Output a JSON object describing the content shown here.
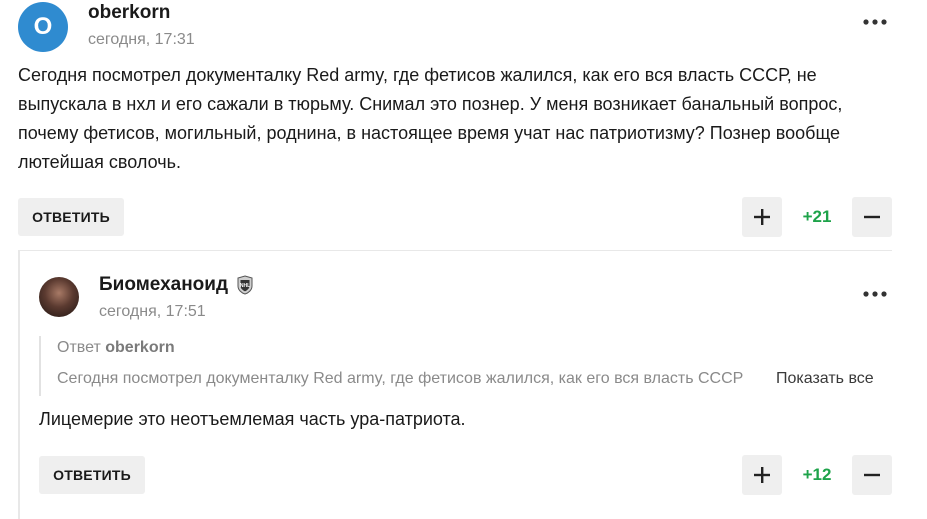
{
  "comment": {
    "avatar_letter": "O",
    "author": "oberkorn",
    "time": "сегодня, 17:31",
    "text_lines": [
      "Сегодня посмотрел документалку Red army, где фетисов жалился, как его вся власть СССР, не",
      "выпускала в нхл и его сажали в тюрьму. Снимал это познер. У меня возникает банальный вопрос,",
      "почему фетисов, могильный, роднина, в настоящее время учат нас патриотизму? Познер вообще",
      "лютейшая сволочь."
    ],
    "reply_label": "ОТВЕТИТЬ",
    "score": "+21"
  },
  "reply": {
    "author": "Биомеханоид",
    "time": "сегодня, 17:51",
    "quote_prefix": "Ответ",
    "quote_author": "oberkorn",
    "quote_text": "Сегодня посмотрел документалку Red army, где фетисов жалился, как его вся власть СССР",
    "show_all_label": "Показать все",
    "text": "Лицемерие это неотъемлемая часть ура-патриота.",
    "reply_label": "ОТВЕТИТЬ",
    "score": "+12"
  },
  "colors": {
    "avatar_bg": "#2f8bd0",
    "score_positive": "#1ea34a",
    "button_bg": "#efefef"
  },
  "icons": {
    "more": "more-dots-icon",
    "upvote": "plus-icon",
    "downvote": "minus-icon",
    "badge": "nhl-badge-icon"
  }
}
